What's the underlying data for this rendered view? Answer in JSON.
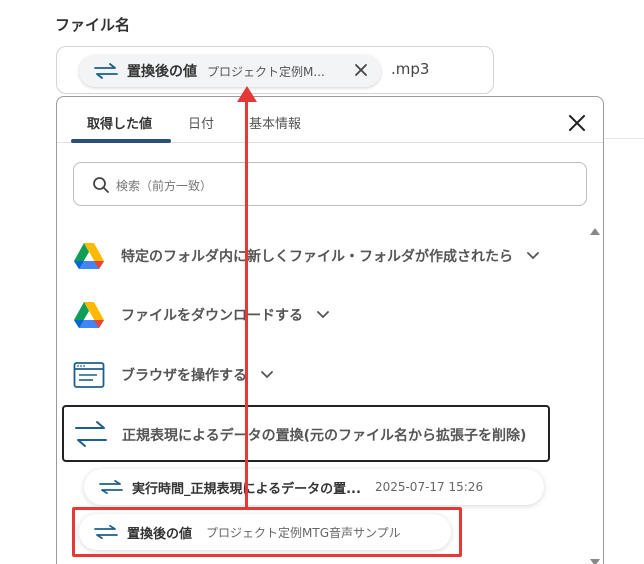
{
  "field": {
    "label": "ファイル名",
    "suffix": ".mp3"
  },
  "chip": {
    "label": "置換後の値",
    "value": "プロジェクト定例M..."
  },
  "tabs": [
    {
      "label": "取得した値"
    },
    {
      "label": "日付"
    },
    {
      "label": "基本情報"
    }
  ],
  "search": {
    "placeholder": "検索（前方一致）"
  },
  "items": [
    {
      "label": "特定のフォルダ内に新しくファイル・フォルダが作成されたら",
      "icon": "google-drive-icon"
    },
    {
      "label": "ファイルをダウンロードする",
      "icon": "google-drive-icon"
    },
    {
      "label": "ブラウザを操作する",
      "icon": "browser-window-icon"
    },
    {
      "label": "正規表現によるデータの置換(元のファイル名から拡張子を削除)",
      "icon": "swap-arrows-icon"
    }
  ],
  "sub_items": [
    {
      "label": "実行時間_正規表現によるデータの置...",
      "value": "2025-07-17 15:26"
    },
    {
      "label": "置換後の値",
      "value": "プロジェクト定例MTG音声サンプル"
    }
  ],
  "colors": {
    "accent": "#2b4f7a",
    "annotation": "#e53935",
    "swap_icon": "#1e5e8c"
  }
}
